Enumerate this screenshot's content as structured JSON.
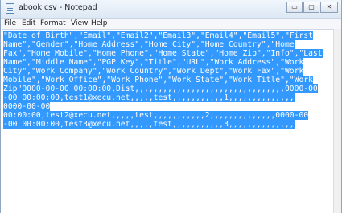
{
  "window": {
    "title": "abook.csv - Notepad",
    "icon": "notepad-icon",
    "controls": {
      "minimize": "▭",
      "maximize": "▢",
      "close": "✕"
    }
  },
  "menu": {
    "items": [
      "File",
      "Edit",
      "Format",
      "View",
      "Help"
    ]
  },
  "editor": {
    "selection_color": "#3399ff",
    "lines": [
      "\"Date of Birth\",\"Email\",\"Email2\",\"Email3\",\"Email4\",\"Email5\",\"First",
      "Name\",\"Gender\",\"Home Address\",\"Home City\",\"Home Country\",\"Home",
      "Fax\",\"Home Mobile\",\"Home Phone\",\"Home State\",\"Home Zip\",\"Info\",\"Last",
      "Name\",\"Middle Name\",\"PGP Key\",\"Title\",\"URL\",\"Work Address\",\"Work",
      "City\",\"Work Company\",\"Work Country\",\"Work Dept\",\"Work Fax\",\"Work",
      "Mobile\",\"Work Office\",\"Work Phone\",\"Work State\",\"Work Title\",\"Work",
      "Zip\"0000-00-00 00:00:00,Dist,,,,,,,,,,,,,,,,,,,,,,,,,,,,,,,,0000-00",
      "-00 00:00:00,test1@xecu.net,,,,,test,,,,,,,,,,,1,,,,,,,,,,,,,,",
      "0000-00-00",
      "00:00:00,test2@xecu.net,,,,,test,,,,,,,,,,,2,,,,,,,,,,,,,,0000-00",
      "-00 00:00:00,test3@xecu.net,,,,,test,,,,,,,,,,,3,,,,,,,,,,,,,,"
    ]
  }
}
